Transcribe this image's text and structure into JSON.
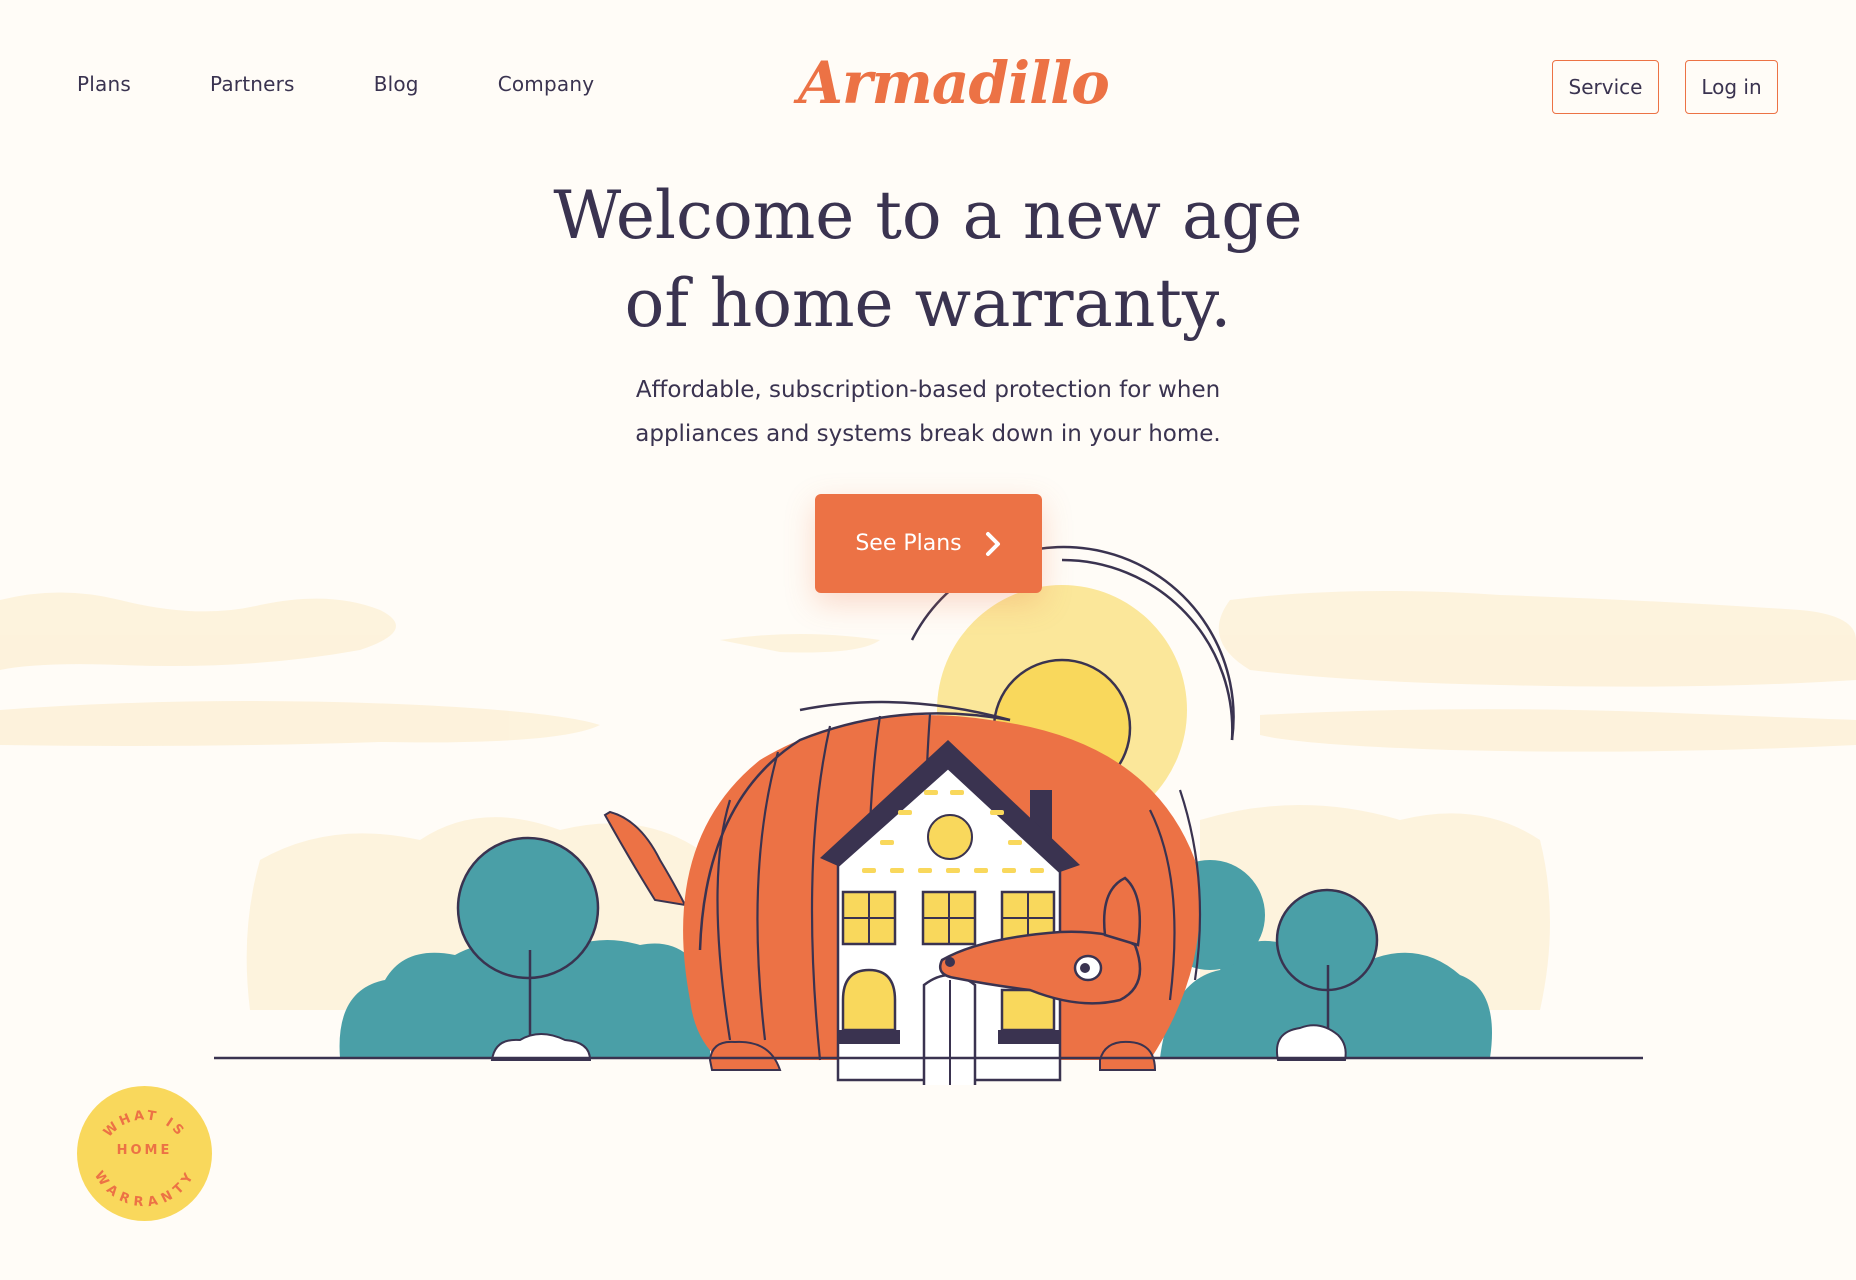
{
  "nav": {
    "links": [
      "Plans",
      "Partners",
      "Blog",
      "Company"
    ],
    "logo": "Armadillo",
    "service_label": "Service",
    "login_label": "Log in"
  },
  "hero": {
    "title_line1": "Welcome to a new age",
    "title_line2": "of home warranty.",
    "subtitle_line1": "Affordable, subscription-based protection for when",
    "subtitle_line2": "appliances and systems break down in your home.",
    "cta_label": "See Plans",
    "cta_icon": "chevron-right-icon"
  },
  "badge": {
    "arc_top": "WHAT IS",
    "center": "HOME",
    "arc_bottom": "WARRANTY"
  },
  "colors": {
    "accent": "#ec7245",
    "text": "#3a3350",
    "background": "#fffcf7",
    "teal": "#4a9fa7",
    "sun": "#f9d85c"
  }
}
